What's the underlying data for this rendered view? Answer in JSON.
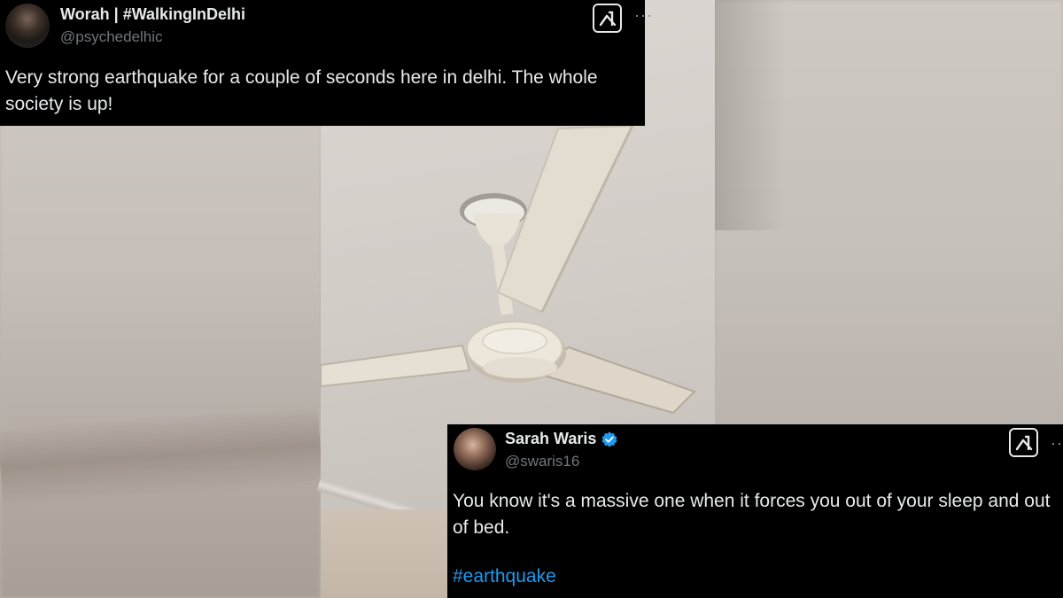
{
  "tweets": [
    {
      "name": "Worah | #WalkingInDelhi",
      "handle": "@psychedelhic",
      "text": "Very strong earthquake for a couple of seconds here in delhi. The whole society is up!",
      "more": "···",
      "verified": false
    },
    {
      "name": "Sarah Waris",
      "handle": "@swaris16",
      "text": "You know it's a massive one when it forces you out of your sleep and out of bed.",
      "hashtag": "#earthquake",
      "more": "···",
      "verified": true
    }
  ],
  "colors": {
    "card_bg": "#000000",
    "name": "#e7e9ea",
    "handle": "#71767b",
    "hashtag": "#1d9bf0",
    "verified": "#1d9bf0"
  },
  "icons": [
    "grok-icon",
    "more-icon",
    "verified-badge-icon",
    "avatar"
  ]
}
